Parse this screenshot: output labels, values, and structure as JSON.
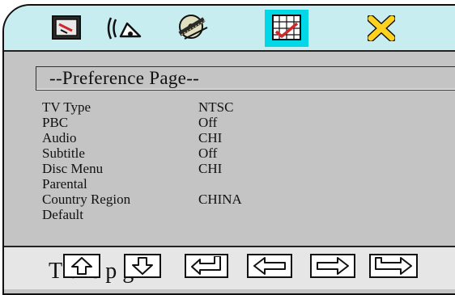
{
  "tabs": [
    {
      "id": "general-setup",
      "icon": "tv-set-icon"
    },
    {
      "id": "audio-setup",
      "icon": "speaker-sound-icon"
    },
    {
      "id": "video-setup",
      "icon": "disc-film-icon"
    },
    {
      "id": "preference-setup",
      "icon": "grid-checkmark-icon"
    },
    {
      "id": "exit-setup",
      "icon": "exit-cross-icon"
    }
  ],
  "page": {
    "title": "--Preference Page--"
  },
  "settings": [
    {
      "label": "TV Type",
      "value": "NTSC"
    },
    {
      "label": "PBC",
      "value": "Off"
    },
    {
      "label": "Audio",
      "value": "CHI"
    },
    {
      "label": "Subtitle",
      "value": "Off"
    },
    {
      "label": "Disc Menu",
      "value": "CHI"
    },
    {
      "label": "Parental",
      "value": ""
    },
    {
      "label": "Country Region",
      "value": "CHINA"
    },
    {
      "label": "Default",
      "value": ""
    }
  ],
  "footer": {
    "hint": "T      el      c    p g"
  },
  "nav_buttons": [
    "up-arrow-icon",
    "down-arrow-icon",
    "enter-arrow-icon",
    "left-arrow-icon",
    "right-arrow-icon",
    "tab-arrow-icon"
  ],
  "colors": {
    "top_band": "#c8edf0",
    "panel": "#c4c4c4",
    "highlight": "#00d8e8",
    "accent_red": "#d0282a",
    "exit_yellow": "#ffd21e"
  }
}
